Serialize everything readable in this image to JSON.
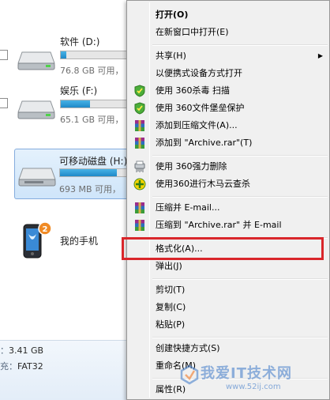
{
  "explorer": {
    "drives": [
      {
        "name": "软件 (D:)",
        "free": "76.8 GB 可用，",
        "usage": 0.08
      },
      {
        "name": "娱乐 (F:)",
        "free": "65.1 GB 可用，",
        "usage": 0.42
      },
      {
        "name": "可移动磁盘 (H:)",
        "free": "693 MB 可用，",
        "usage": 0.78
      }
    ],
    "phone_name": "我的手机",
    "phone_badge": "2",
    "details": [
      {
        "key": "：",
        "value": "3.41 GB"
      },
      {
        "key": "充：",
        "value": "FAT32"
      }
    ]
  },
  "menu": {
    "items": [
      {
        "label": "打开(O)",
        "bold": true
      },
      {
        "label": "在新窗口中打开(E)"
      },
      {
        "label": "共享(H)",
        "submenu": true
      },
      {
        "label": "以便携式设备方式打开"
      },
      {
        "label": "使用 360杀毒 扫描",
        "icon": "shield-360-icon"
      },
      {
        "label": "使用 360文件堡垒保护",
        "icon": "shield-360-icon"
      },
      {
        "label": "添加到压缩文件(A)...",
        "icon": "winrar-icon"
      },
      {
        "label": "添加到 \"Archive.rar\"(T)",
        "icon": "winrar-icon"
      },
      {
        "label": "使用 360强力删除",
        "icon": "shredder-icon"
      },
      {
        "label": "使用360进行木马云查杀",
        "icon": "trojan-scan-icon"
      },
      {
        "label": "压缩并 E-mail...",
        "icon": "winrar-icon"
      },
      {
        "label": "压缩到 \"Archive.rar\" 并 E-mail",
        "icon": "winrar-icon"
      },
      {
        "label": "格式化(A)..."
      },
      {
        "label": "弹出(J)"
      },
      {
        "label": "剪切(T)"
      },
      {
        "label": "复制(C)"
      },
      {
        "label": "粘贴(P)"
      },
      {
        "label": "创建快捷方式(S)"
      },
      {
        "label": "重命名(M)"
      },
      {
        "label": "属性(R)"
      }
    ],
    "arrow": "▶"
  },
  "watermark": {
    "text": "我爱IT技术网",
    "url": "www.52ij.com"
  },
  "colors": {
    "menu_bg": "#f0f0f0",
    "highlight_border": "#d9262b",
    "drive_fill": "#1f89c8",
    "selection_bg": "#cfe5fa"
  }
}
